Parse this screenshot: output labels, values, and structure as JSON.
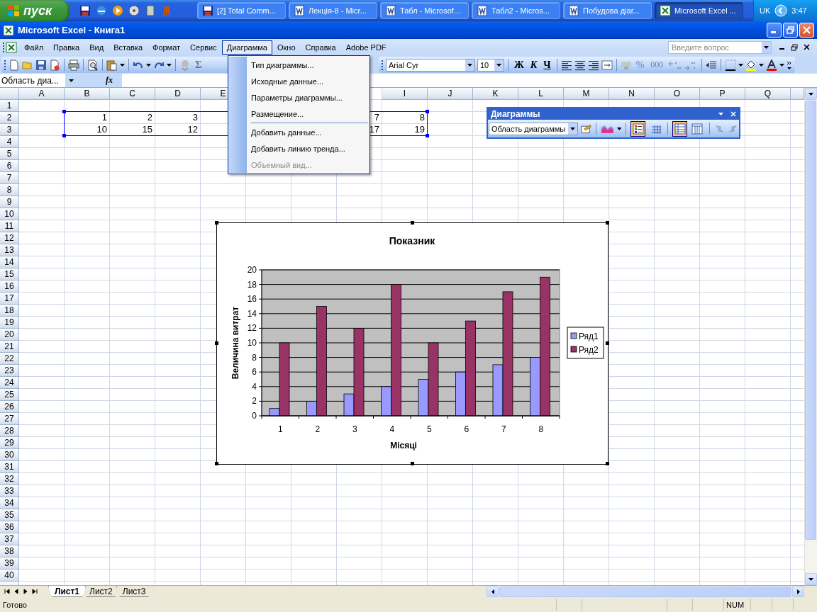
{
  "taskbar": {
    "start": "пуск",
    "tasks": [
      {
        "label": "[2] Total Comm...",
        "kind": "commander",
        "selected": false
      },
      {
        "label": "Лекція-8 - Micr...",
        "kind": "word",
        "selected": false
      },
      {
        "label": "Табл - Microsof...",
        "kind": "word",
        "selected": false
      },
      {
        "label": "Табл2 - Micros...",
        "kind": "word",
        "selected": false
      },
      {
        "label": "Побудова діаг...",
        "kind": "word",
        "selected": false
      },
      {
        "label": "Microsoft Excel ...",
        "kind": "excel",
        "selected": true
      }
    ],
    "language": "UK",
    "clock": "3:47"
  },
  "window": {
    "title": "Microsoft Excel - Книга1"
  },
  "menu": {
    "items": [
      {
        "label": "Файл",
        "selected": false
      },
      {
        "label": "Правка",
        "selected": false
      },
      {
        "label": "Вид",
        "selected": false
      },
      {
        "label": "Вставка",
        "selected": false
      },
      {
        "label": "Формат",
        "selected": false
      },
      {
        "label": "Сервис",
        "selected": false
      },
      {
        "label": "Диаграмма",
        "selected": true
      },
      {
        "label": "Окно",
        "selected": false
      },
      {
        "label": "Справка",
        "selected": false
      },
      {
        "label": "Adobe PDF",
        "selected": false
      }
    ],
    "help_placeholder": "Введите вопрос"
  },
  "toolbar": {
    "sum": "Σ",
    "font": "Arial Cyr",
    "size": "10",
    "bold": "Ж",
    "italic": "К",
    "underline": "Ч",
    "percent": "%",
    "thousands": "000"
  },
  "formula_bar": {
    "name_box": "Область диа...",
    "fx": "fx"
  },
  "sheet": {
    "columns_left": [
      "A",
      "B",
      "C",
      "D",
      "E"
    ],
    "columns_right": [
      "I",
      "J",
      "K",
      "L",
      "M",
      "N",
      "O",
      "P",
      "Q"
    ],
    "rows": [
      {
        "label": "1"
      },
      {
        "label": "2",
        "cells": {
          "B": "1",
          "C": "2",
          "D": "3",
          "H": "7",
          "I": "8"
        }
      },
      {
        "label": "3",
        "cells": {
          "B": "10",
          "C": "15",
          "D": "12",
          "H": "17",
          "I": "19"
        }
      },
      {
        "label": "4"
      },
      {
        "label": "5"
      },
      {
        "label": "6"
      },
      {
        "label": "7"
      },
      {
        "label": "8"
      },
      {
        "label": "9"
      },
      {
        "label": "10"
      },
      {
        "label": "11"
      },
      {
        "label": "12"
      },
      {
        "label": "13"
      },
      {
        "label": "14"
      },
      {
        "label": "15"
      },
      {
        "label": "16"
      },
      {
        "label": "17"
      },
      {
        "label": "18"
      },
      {
        "label": "19"
      },
      {
        "label": "20"
      },
      {
        "label": "21"
      },
      {
        "label": "22"
      },
      {
        "label": "23"
      },
      {
        "label": "24"
      },
      {
        "label": "25"
      },
      {
        "label": "26"
      },
      {
        "label": "27"
      },
      {
        "label": "28"
      },
      {
        "label": "29"
      },
      {
        "label": "30"
      },
      {
        "label": "31"
      },
      {
        "label": "32"
      },
      {
        "label": "33"
      },
      {
        "label": "34"
      },
      {
        "label": "35"
      },
      {
        "label": "36"
      },
      {
        "label": "37"
      },
      {
        "label": "38"
      },
      {
        "label": "39"
      },
      {
        "label": "40"
      }
    ]
  },
  "chart_menu": {
    "groups": [
      [
        {
          "label": "Тип диаграммы...",
          "disabled": false
        },
        {
          "label": "Исходные данные...",
          "disabled": false
        },
        {
          "label": "Параметры диаграммы...",
          "disabled": false
        },
        {
          "label": "Размещение...",
          "disabled": false
        }
      ],
      [
        {
          "label": "Добавить данные...",
          "disabled": false
        },
        {
          "label": "Добавить линию тренда...",
          "disabled": false
        },
        {
          "label": "Объемный вид...",
          "disabled": true
        }
      ]
    ]
  },
  "chart": {
    "chart_data": {
      "type": "bar",
      "title": "Показник",
      "xlabel": "Місяці",
      "ylabel": "Величина витрат",
      "categories": [
        "1",
        "2",
        "3",
        "4",
        "5",
        "6",
        "7",
        "8"
      ],
      "series": [
        {
          "name": "Ряд1",
          "color": "#9999ff",
          "values": [
            1,
            2,
            3,
            4,
            5,
            6,
            7,
            8
          ]
        },
        {
          "name": "Ряд2",
          "color": "#993366",
          "values": [
            10,
            15,
            12,
            18,
            10,
            13,
            17,
            19
          ]
        }
      ],
      "ylim": [
        0,
        20
      ],
      "yticks": [
        0,
        2,
        4,
        6,
        8,
        10,
        12,
        14,
        16,
        18,
        20
      ],
      "grid": true,
      "legend": true
    }
  },
  "chart_toolbar": {
    "title": "Диаграммы",
    "object": "Область диаграммы",
    "buttons": [
      {
        "kind": "format"
      },
      {
        "kind": "chart-type"
      },
      {
        "kind": "legend",
        "pressed": true
      },
      {
        "kind": "data-table",
        "pressed": false
      },
      {
        "kind": "by-row",
        "pressed": true
      },
      {
        "kind": "by-column",
        "pressed": false
      },
      {
        "kind": "angle-down"
      },
      {
        "kind": "angle-up"
      }
    ]
  },
  "sheet_tabs": [
    {
      "label": "Лист1",
      "selected": true
    },
    {
      "label": "Лист2",
      "selected": false
    },
    {
      "label": "Лист3",
      "selected": false
    }
  ],
  "status_bar": {
    "text": "Готово",
    "num": "NUM"
  }
}
